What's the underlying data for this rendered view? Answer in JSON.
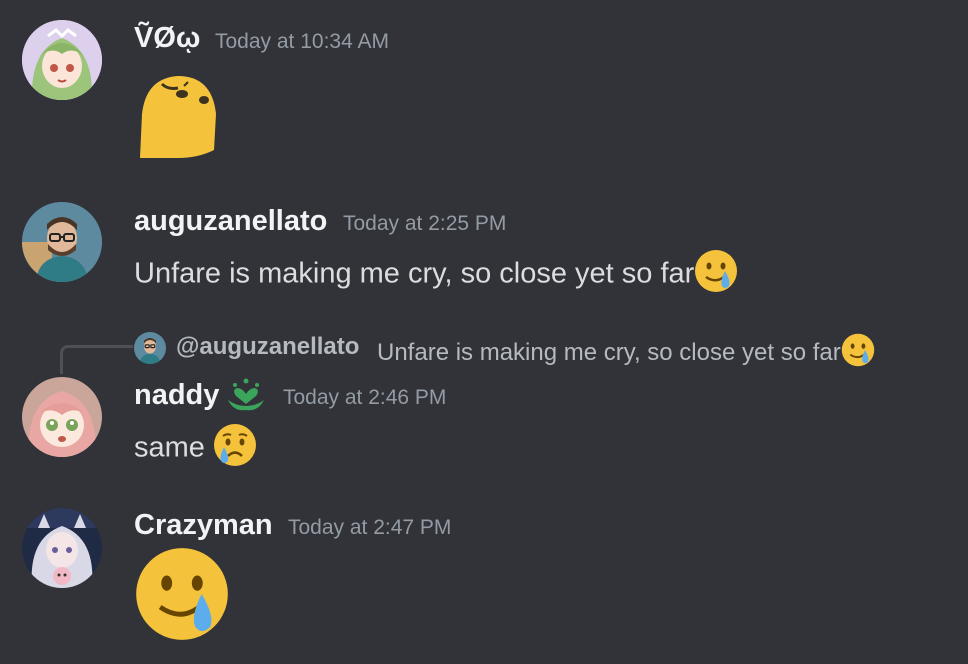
{
  "messages": [
    {
      "username": "ṼØῳ",
      "timestamp": "Today at 10:34 AM",
      "content": "",
      "avatar_icon": "anime-girl-green-hair-avatar",
      "sticker_icon": "yellow-blob-sticker"
    },
    {
      "username": "auguzanellato",
      "timestamp": "Today at 2:25 PM",
      "content": "Unfare is making me cry, so close yet so far",
      "avatar_icon": "man-with-glasses-avatar",
      "emoji": "smiling-face-with-tear"
    },
    {
      "username": "naddy",
      "timestamp": "Today at 2:46 PM",
      "content": "same",
      "avatar_icon": "anime-girl-pink-hair-avatar",
      "badge_icon": "green-heart-hands-badge",
      "emoji": "crying-face"
    },
    {
      "username": "Crazyman",
      "timestamp": "Today at 2:47 PM",
      "content": "",
      "avatar_icon": "anime-girl-silver-hair-avatar",
      "emoji": "smiling-face-with-tear"
    }
  ],
  "reply": {
    "mention": "@auguzanellato",
    "text": "Unfare is making me cry, so close yet so far",
    "emoji": "smiling-face-with-tear"
  },
  "colors": {
    "background": "#313338",
    "username": "#f2f3f5",
    "timestamp": "#949ba4",
    "text": "#dbdee1",
    "emoji_yellow": "#f5c33b",
    "tear_blue": "#5dadec",
    "badge_green": "#3ba55c"
  }
}
